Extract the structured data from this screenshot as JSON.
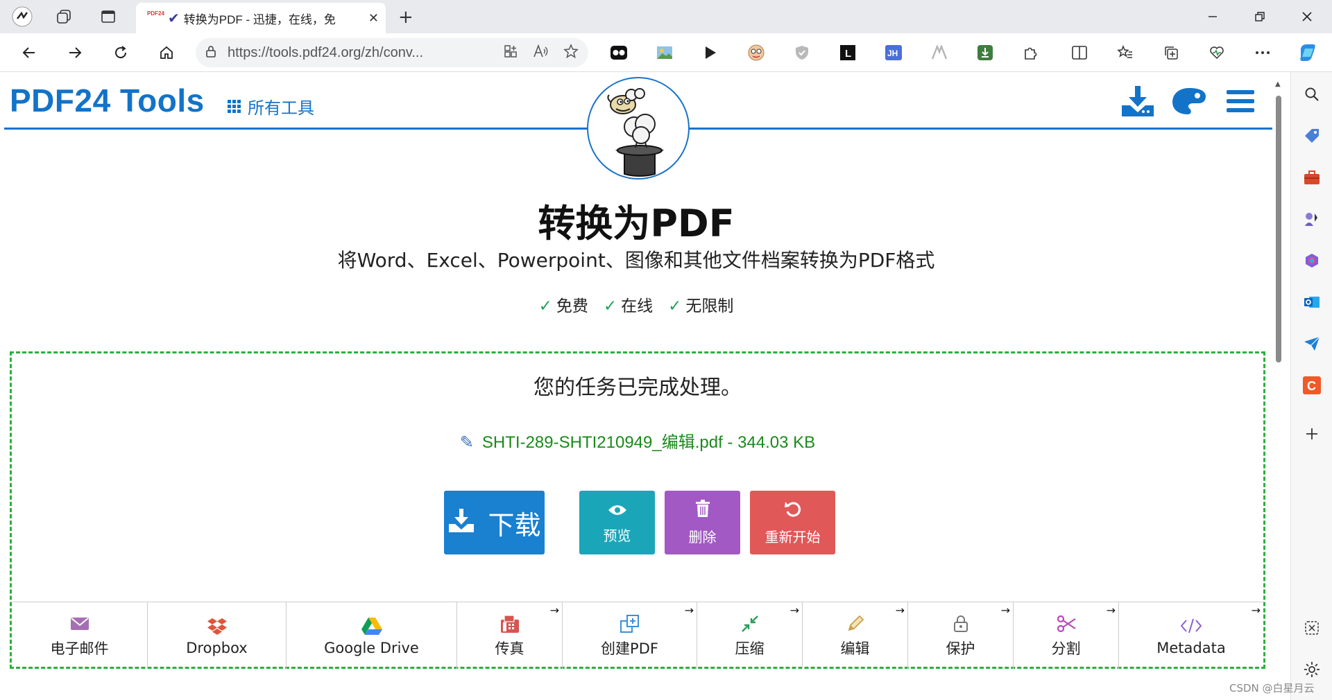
{
  "browser": {
    "tab_title": "转换为PDF - 迅捷，在线，免",
    "tab_favicon": "PDF24",
    "url": "https://tools.pdf24.org/zh/conv...",
    "new_tab": "+",
    "tab_close": "✕"
  },
  "header": {
    "brand": "PDF24 Tools",
    "all_tools": "所有工具"
  },
  "hero": {
    "title": "转换为PDF",
    "subtitle": "将Word、Excel、Powerpoint、图像和其他文件档案转换为PDF格式",
    "features": [
      "免费",
      "在线",
      "无限制"
    ],
    "check": "✓"
  },
  "result": {
    "message": "您的任务已完成处理。",
    "file": "SHTI-289-SHTI210949_编辑.pdf - 344.03 KB",
    "buttons": {
      "download": "下载",
      "preview": "预览",
      "delete": "删除",
      "restart": "重新开始"
    },
    "tools": [
      {
        "label": "电子邮件",
        "icon": "envelope-icon",
        "color": "#a66fb5"
      },
      {
        "label": "Dropbox",
        "icon": "dropbox-icon",
        "color": "#e0553a"
      },
      {
        "label": "Google Drive",
        "icon": "google-drive-icon",
        "color": "#34a853"
      },
      {
        "label": "传真",
        "icon": "fax-icon",
        "color": "#d9534f"
      },
      {
        "label": "创建PDF",
        "icon": "create-pdf-icon",
        "color": "#3d8fd4"
      },
      {
        "label": "压缩",
        "icon": "compress-icon",
        "color": "#2e9e5a"
      },
      {
        "label": "编辑",
        "icon": "pencil-icon",
        "color": "#c9a04a"
      },
      {
        "label": "保护",
        "icon": "lock-icon",
        "color": "#777"
      },
      {
        "label": "分割",
        "icon": "scissors-icon",
        "color": "#b84ab8"
      },
      {
        "label": "Metadata",
        "icon": "code-icon",
        "color": "#8a5fd0"
      }
    ],
    "tool_arrow": "→"
  },
  "watermark": "CSDN @白星月云",
  "colors": {
    "brand": "#1273c9",
    "download": "#1a80d0",
    "preview": "#1aa6b8",
    "delete": "#a259c4",
    "restart": "#e05858",
    "dashed_border": "#2ab03e",
    "file_link": "#1a8a1a"
  }
}
